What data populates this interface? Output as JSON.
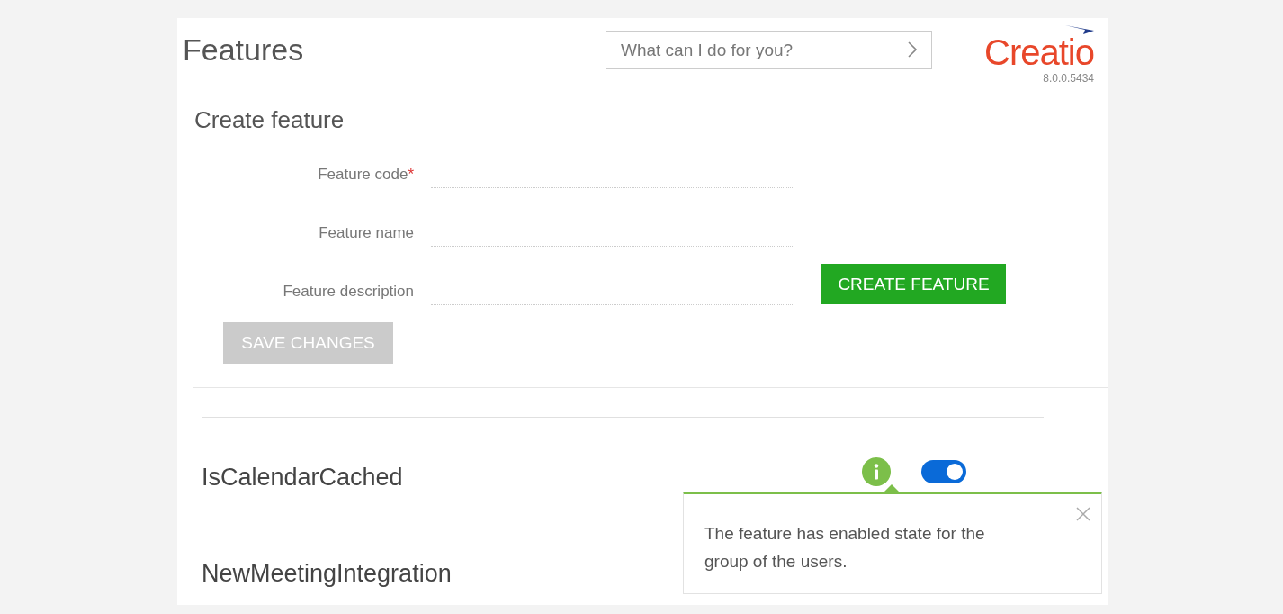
{
  "header": {
    "title": "Features",
    "search": {
      "placeholder": "What can I do for you?"
    },
    "logo": "Creatio",
    "version": "8.0.0.5434"
  },
  "form": {
    "title": "Create feature",
    "fields": [
      {
        "label": "Feature code",
        "required_mark": "*"
      },
      {
        "label": "Feature name"
      },
      {
        "label": "Feature description"
      }
    ],
    "create_button": "CREATE FEATURE",
    "save_button": {
      "label": "SAVE CHANGES",
      "disabled": true
    }
  },
  "features": [
    {
      "name": "IsCalendarCached",
      "info": true,
      "on": true
    },
    {
      "name": "NewMeetingIntegration"
    }
  ],
  "tooltip": {
    "text": "The feature has enabled state for the group of the users."
  }
}
